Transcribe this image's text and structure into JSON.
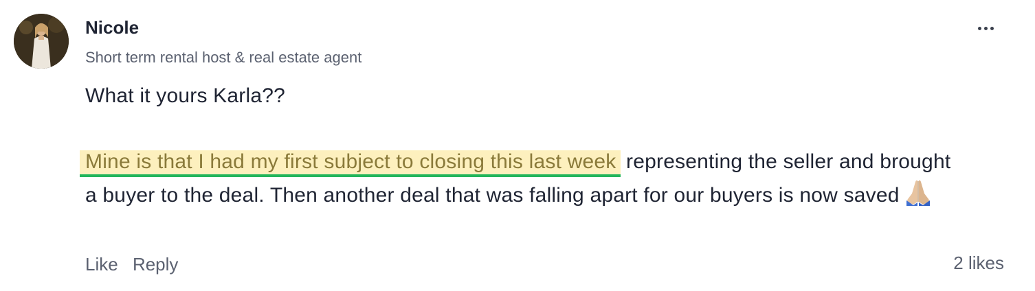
{
  "comment": {
    "author": {
      "name": "Nicole",
      "bio": "Short term rental host & real estate agent"
    },
    "body": {
      "line1": "What it yours Karla??",
      "highlighted": "Mine is that I had my first subject to closing this last week",
      "rest": " representing the seller and brought a buyer to the deal. Then another deal that was falling apart for our buyers is now saved"
    },
    "actions": {
      "like_label": "Like",
      "reply_label": "Reply"
    },
    "likes_label": "2 likes"
  },
  "icons": {
    "more": "more-horizontal-icon",
    "emoji": "folded-hands-emoji"
  },
  "colors": {
    "highlight_bg": "#fdf0be",
    "highlight_underline": "#22b55c",
    "muted_text": "#5b6170"
  }
}
